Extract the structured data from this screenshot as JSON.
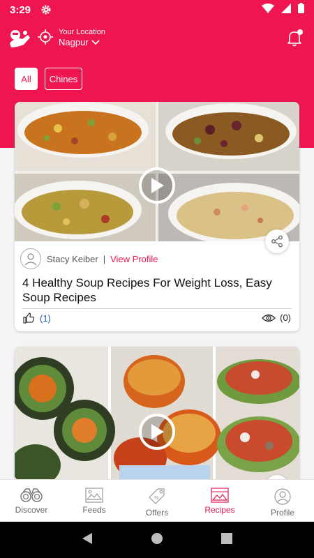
{
  "status_bar": {
    "time": "3:29"
  },
  "header": {
    "location_label": "Your Location",
    "location_city": "Nagpur"
  },
  "filters": [
    {
      "label": "All",
      "selected": true
    },
    {
      "label": "Chines",
      "selected": false
    }
  ],
  "cards": [
    {
      "author": "Stacy Keiber",
      "separator": "|",
      "view_profile": "View Profile",
      "title": "4 Healthy Soup Recipes For Weight Loss, Easy Soup Recipes",
      "likes": "(1)",
      "views": "(0)"
    },
    {
      "author": "",
      "title": ""
    }
  ],
  "bottom_nav": [
    {
      "label": "Discover",
      "icon": "binoculars-icon"
    },
    {
      "label": "Feeds",
      "icon": "image-icon"
    },
    {
      "label": "Offers",
      "icon": "tag-icon"
    },
    {
      "label": "Recipes",
      "icon": "recipe-icon",
      "active": true
    },
    {
      "label": "Profile",
      "icon": "profile-icon"
    }
  ],
  "colors": {
    "brand": "#ef1550",
    "accent_text": "#e3174f",
    "link": "#1a57b5"
  }
}
